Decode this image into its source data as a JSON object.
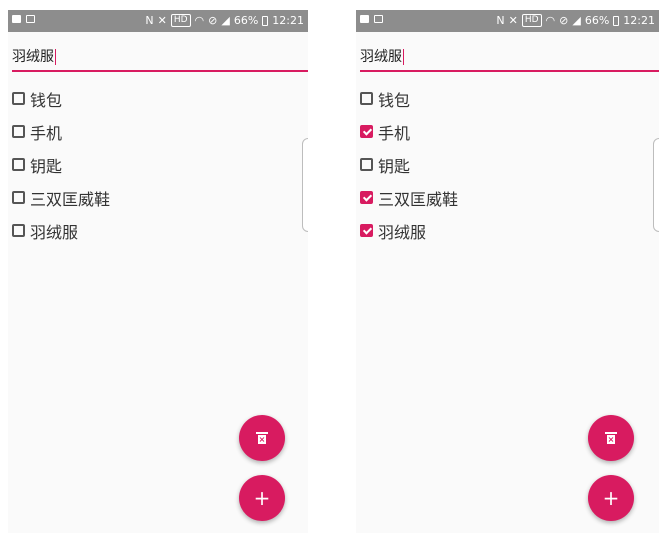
{
  "left": {
    "status": {
      "percent": "66%",
      "time": "12:21",
      "hd": "HD"
    },
    "input": {
      "value": "羽绒服"
    },
    "items": [
      {
        "label": "钱包",
        "checked": false
      },
      {
        "label": "手机",
        "checked": false
      },
      {
        "label": "钥匙",
        "checked": false
      },
      {
        "label": "三双匡威鞋",
        "checked": false
      },
      {
        "label": "羽绒服",
        "checked": false
      }
    ],
    "fab_add": "+"
  },
  "right": {
    "status": {
      "percent": "66%",
      "time": "12:21",
      "hd": "HD"
    },
    "input": {
      "value": "羽绒服"
    },
    "items": [
      {
        "label": "钱包",
        "checked": false
      },
      {
        "label": "手机",
        "checked": true
      },
      {
        "label": "钥匙",
        "checked": false
      },
      {
        "label": "三双匡威鞋",
        "checked": true
      },
      {
        "label": "羽绒服",
        "checked": true
      }
    ],
    "fab_add": "+"
  },
  "colors": {
    "accent": "#d81b60",
    "status_bar": "#8d8d8d"
  },
  "icons": [
    "image-icon",
    "cast-icon",
    "nfc-icon",
    "mute-icon",
    "wifi-icon",
    "do-not-disturb-icon",
    "signal-icon",
    "battery-icon",
    "delete-icon",
    "add-icon"
  ]
}
